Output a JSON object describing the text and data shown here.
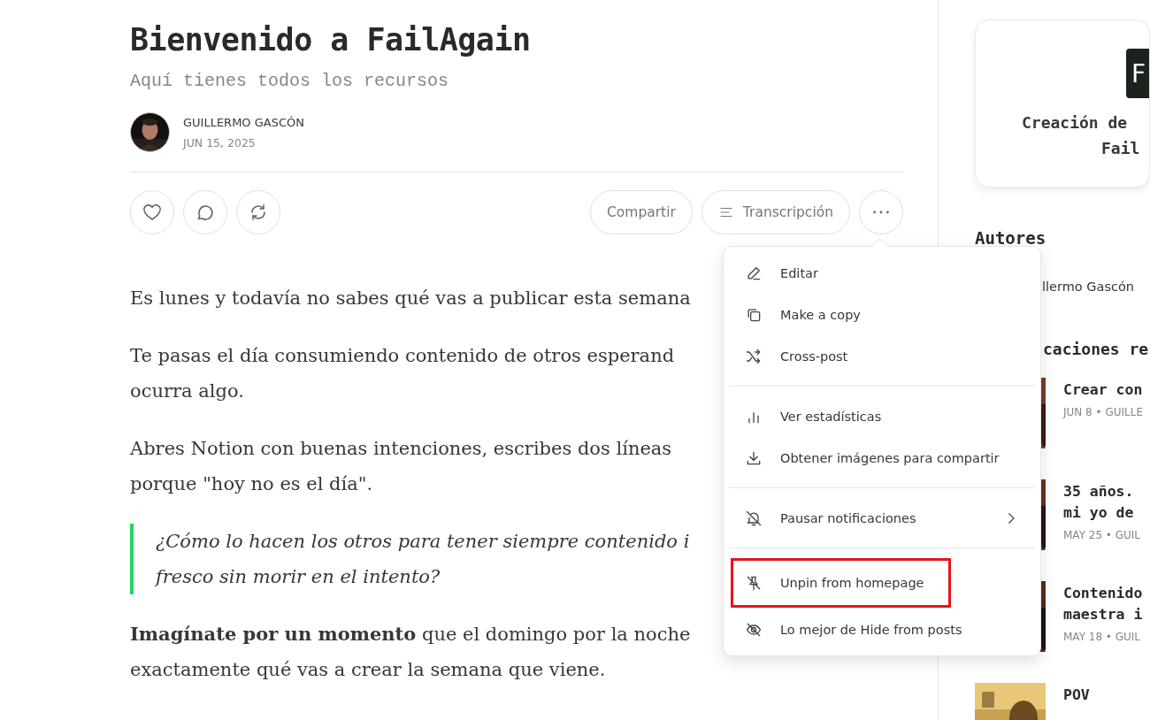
{
  "post": {
    "title": "Bienvenido a FailAgain",
    "subtitle": "Aquí tienes todos los recursos",
    "author": "GUILLERMO GASCÓN",
    "date": "JUN 15, 2025",
    "actions": {
      "share": "Compartir",
      "transcript": "Transcripción"
    },
    "body": [
      {
        "kind": "paragraph",
        "lines": [
          "Es lunes y todavía no sabes qué vas a publicar esta semana"
        ]
      },
      {
        "kind": "paragraph",
        "lines": [
          "Te pasas el día consumiendo contenido de otros esperand",
          "ocurra algo."
        ]
      },
      {
        "kind": "paragraph",
        "lines": [
          "Abres Notion con buenas intenciones, escribes dos líneas",
          "porque \"hoy no es el día\"."
        ]
      },
      {
        "kind": "quote",
        "lines": [
          "¿Cómo lo hacen los otros para tener siempre contenido i",
          "fresco sin morir en el intento?"
        ]
      },
      {
        "kind": "paragraph",
        "lines": [
          "**Imagínate por un momento** que el domingo por la noche",
          "exactamente qué vas a crear la semana que viene."
        ]
      }
    ]
  },
  "menu": {
    "groups": [
      [
        {
          "label": "Editar",
          "has_submenu": false,
          "highlighted": false
        },
        {
          "label": "Make a copy",
          "has_submenu": false,
          "highlighted": false
        },
        {
          "label": "Cross-post",
          "has_submenu": false,
          "highlighted": false
        }
      ],
      [
        {
          "label": "Ver estadísticas",
          "has_submenu": false,
          "highlighted": false
        },
        {
          "label": "Obtener imágenes para compartir",
          "has_submenu": false,
          "highlighted": false
        }
      ],
      [
        {
          "label": "Pausar notificaciones",
          "has_submenu": true,
          "highlighted": false
        }
      ],
      [
        {
          "label": "Unpin from homepage",
          "has_submenu": false,
          "highlighted": true
        },
        {
          "label": "Lo mejor de Hide from posts",
          "has_submenu": false,
          "highlighted": false
        }
      ]
    ]
  },
  "sidebar": {
    "card": {
      "logo": "F",
      "title_lines": [
        "Creación de",
        "Fail"
      ]
    },
    "authors_heading": "Autores",
    "author": "llermo Gascón",
    "posts_heading": "caciones re",
    "posts": [
      {
        "title_lines": [
          "Crear con"
        ],
        "meta": "JUN 8 • GUILLE"
      },
      {
        "title_lines": [
          "35 años.",
          "mi yo de"
        ],
        "meta": "MAY 25 • GUIL"
      },
      {
        "title_lines": [
          "Contenido",
          "maestra i"
        ],
        "meta": "MAY 18 • GUIL"
      },
      {
        "title_lines": [
          "POV"
        ]
      }
    ]
  }
}
